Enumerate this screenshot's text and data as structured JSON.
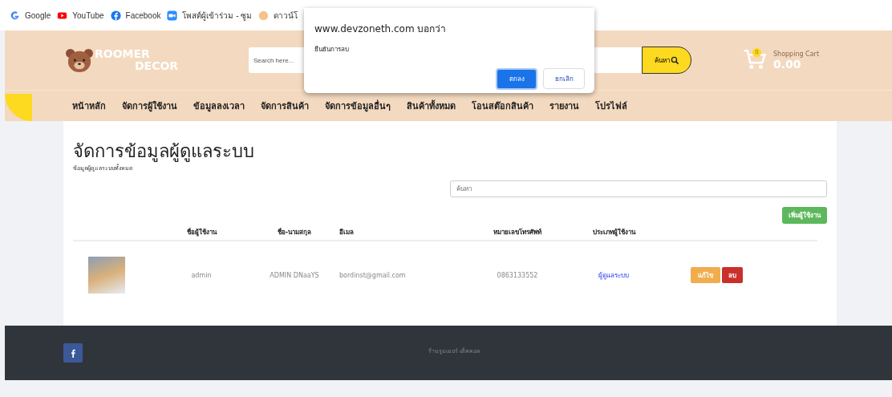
{
  "bookmarks": [
    {
      "label": "Google",
      "kind": "google"
    },
    {
      "label": "YouTube",
      "kind": "youtube"
    },
    {
      "label": "Facebook",
      "kind": "facebook"
    },
    {
      "label": "โพสต์ผู้เข้าร่วม - ซูม",
      "kind": "zoom"
    },
    {
      "label": "ดาวน์โ",
      "kind": "other"
    }
  ],
  "header": {
    "logo_line_1": "ROOMER",
    "logo_line_2": "DECOR",
    "search": {
      "placeholder": "Search here..."
    },
    "search_button": "ค้นหา",
    "cart": {
      "count": "0",
      "label": "Shopping Cart",
      "total": "0.00"
    }
  },
  "nav": [
    "หน้าหลัก",
    "จัดการผู้ใช้งาน",
    "ข้อมูลลงเวลา",
    "จัดการสินค้า",
    "จัดการข้อมูลอื่นๆ",
    "สินค้าทั้งหมด",
    "โอนสต๊อกสินค้า",
    "รายงาน",
    "โปรไฟล์"
  ],
  "page": {
    "title": "จัดการข้อมูลผู้ดูแลระบบ",
    "subtitle": "ข้อมูลผู้ดูแลระบบทั้งหมด",
    "search": {
      "placeholder": "ค้นหา"
    },
    "add_button": "เพิ่มผู้ใช้งาน"
  },
  "table": {
    "columns": [
      "ชื่อผู้ใช้งาน",
      "ชื่อ-นามสกุล",
      "อีเมล",
      "หมายเลขโทรศัพท์",
      "ประเภทผู้ใช้งาน"
    ],
    "rows": [
      {
        "username": "admin",
        "full_name": "ADMIN DNaaYS",
        "email": "bordinst@gmail.com",
        "phone": "0863133552",
        "role": "ผู้ดูแลระบบ",
        "edit": "แก้ไข",
        "delete": "ลบ"
      }
    ]
  },
  "footer": {
    "text": "ร้านรูมเมอร์ เด็คคอล"
  },
  "dialog": {
    "title": "www.devzoneth.com บอกว่า",
    "message": "ยืนยันการลบ",
    "ok": "ตกลง",
    "cancel": "ยกเลิก"
  }
}
